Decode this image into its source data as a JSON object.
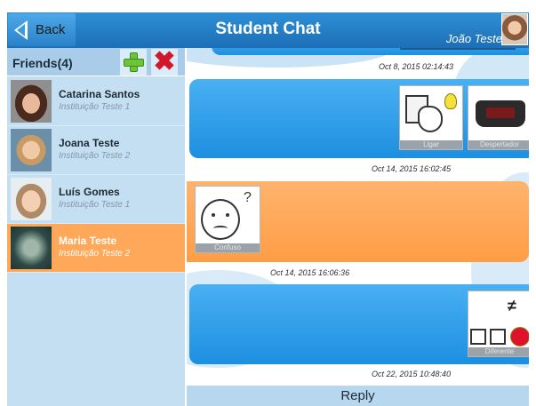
{
  "header": {
    "back_label": "Back",
    "title": "Student Chat",
    "user_name": "João Teste"
  },
  "sidebar": {
    "friends_label": "Friends(4)",
    "friends": [
      {
        "name": "Catarina Santos",
        "institution": "Instituição Teste 1",
        "selected": false
      },
      {
        "name": "Joana Teste",
        "institution": "Instituição Teste 2",
        "selected": false
      },
      {
        "name": "Luís Gomes",
        "institution": "Instituição Teste 1",
        "selected": false
      },
      {
        "name": "Maria Teste",
        "institution": "Instituição Teste 2",
        "selected": true
      }
    ]
  },
  "chat": {
    "messages": [
      {
        "timestamp": "Oct 8, 2015 02:14:43"
      },
      {
        "pictograms": [
          "Ligar",
          "Despertador"
        ],
        "timestamp": "Oct 14, 2015 16:02:45"
      },
      {
        "pictograms": [
          "Confuso"
        ],
        "timestamp": "Oct 14, 2015 16:06:36"
      },
      {
        "pictograms": [
          "Diferente"
        ],
        "timestamp": "Oct 22, 2015 10:48:40"
      }
    ],
    "question_mark": "?",
    "not_equal_symbol": "≠"
  },
  "reply_label": "Reply",
  "colors": {
    "header": "#1d6fb6",
    "bubble_blue": "#2a97e4",
    "bubble_orange": "#ffa552",
    "selected_friend": "#ffa85a",
    "sidebar": "#c5dff2"
  }
}
